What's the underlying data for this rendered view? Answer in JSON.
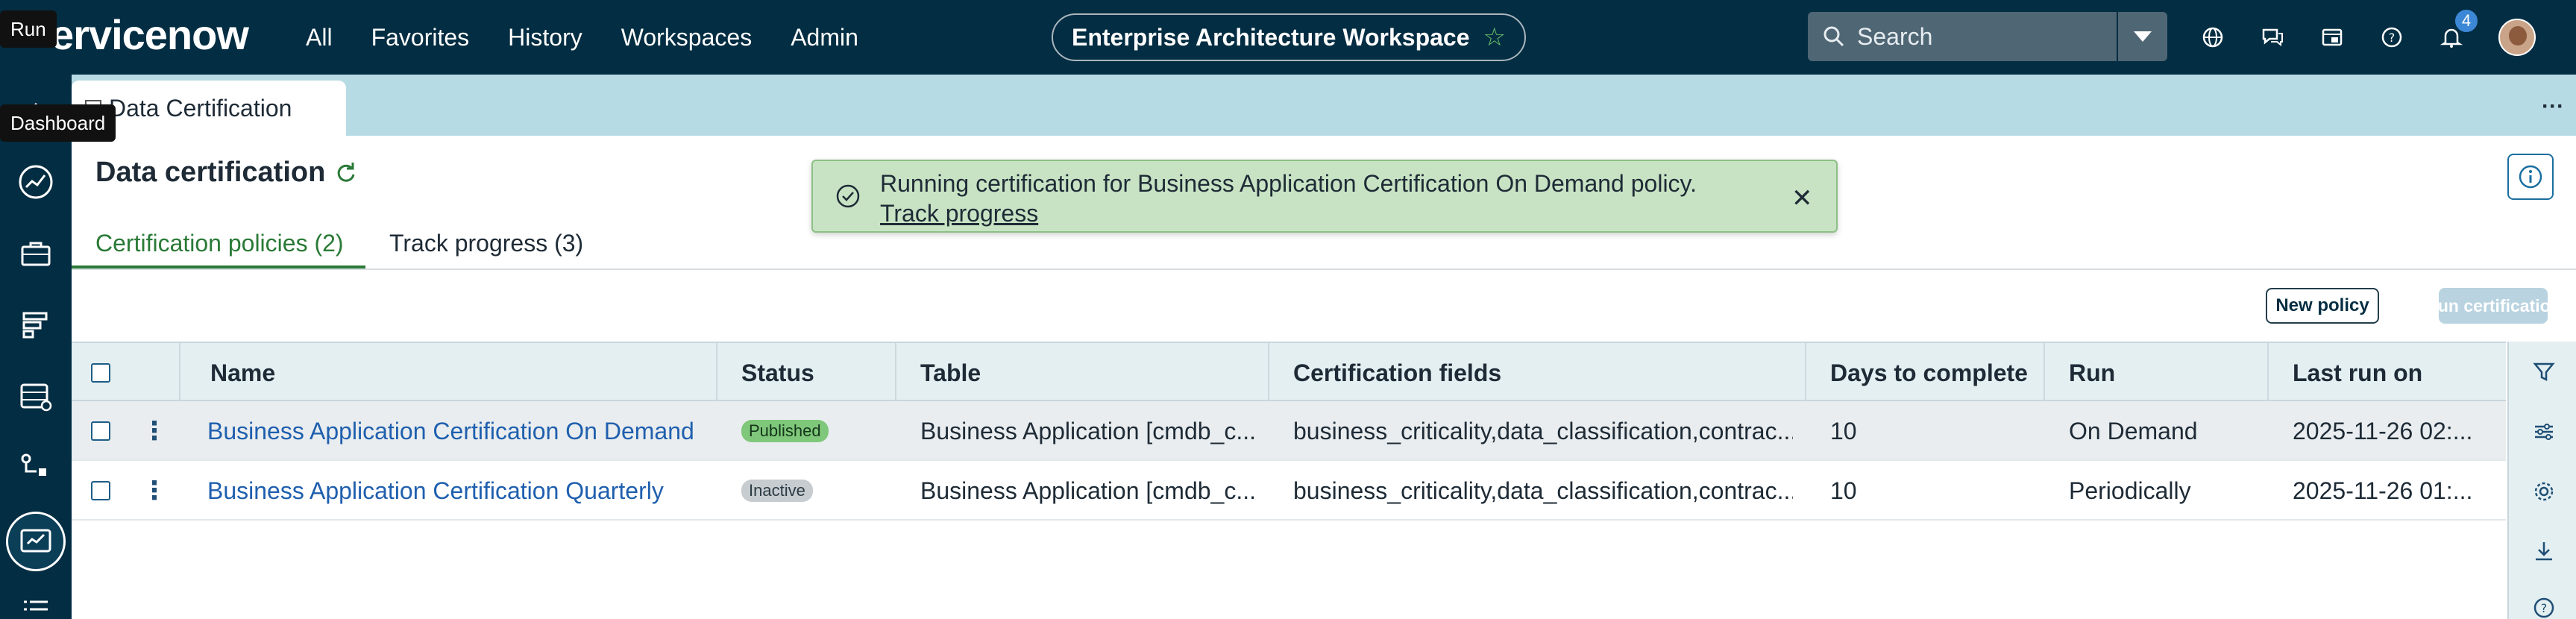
{
  "tooltips": {
    "run": "Run",
    "dashboard": "Dashboard"
  },
  "brand": {
    "logo_text": "ervicenow"
  },
  "nav": {
    "items": [
      "All",
      "Favorites",
      "History",
      "Workspaces",
      "Admin"
    ]
  },
  "workspace": {
    "label": "Enterprise Architecture Workspace"
  },
  "search": {
    "placeholder": "Search"
  },
  "notifications": {
    "count": "4"
  },
  "tab": {
    "label": "Data Certification"
  },
  "page": {
    "title": "Data certification"
  },
  "toast": {
    "message": "Running certification for Business Application Certification On Demand policy.",
    "link": "Track progress"
  },
  "subtabs": {
    "policies": "Certification policies (2)",
    "progress": "Track progress (3)"
  },
  "actions": {
    "new_policy": "New policy",
    "run_certification": "Run certification"
  },
  "table": {
    "headers": {
      "name": "Name",
      "status": "Status",
      "table": "Table",
      "fields": "Certification fields",
      "days": "Days to complete",
      "run": "Run",
      "last_run": "Last run on"
    },
    "rows": [
      {
        "name": "Business Application Certification On Demand",
        "status": "Published",
        "table": "Business Application [cmdb_c...",
        "fields": "business_criticality,data_classification,contrac...",
        "days": "10",
        "run": "On Demand",
        "last_run": "2025-11-26 02:..."
      },
      {
        "name": "Business Application Certification Quarterly",
        "status": "Inactive",
        "table": "Business Application [cmdb_c...",
        "fields": "business_criticality,data_classification,contrac...",
        "days": "10",
        "run": "Periodically",
        "last_run": "2025-11-26 01:..."
      }
    ]
  },
  "colors": {
    "nav_bg": "#032d42",
    "accent_green": "#2a7a37",
    "link_blue": "#1f5fae",
    "toast_bg": "#c8e3c4"
  }
}
